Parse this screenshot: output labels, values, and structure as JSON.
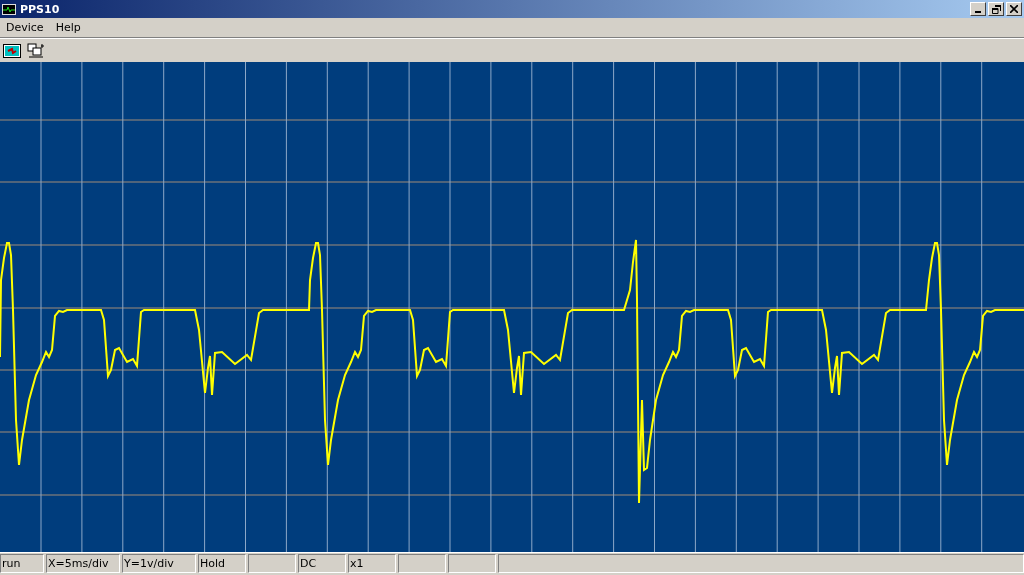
{
  "window": {
    "title": "PPS10"
  },
  "menu": [
    "Device",
    "Help"
  ],
  "toolbar": [
    {
      "kind": "scope"
    },
    {
      "kind": "network"
    }
  ],
  "status_bar": [
    {
      "text": "run"
    },
    {
      "text": "X=5ms/div"
    },
    {
      "text": "Y=1v/div"
    },
    {
      "text": "Hold"
    },
    {
      "text": "DC"
    },
    {
      "text": "x1"
    }
  ]
}
